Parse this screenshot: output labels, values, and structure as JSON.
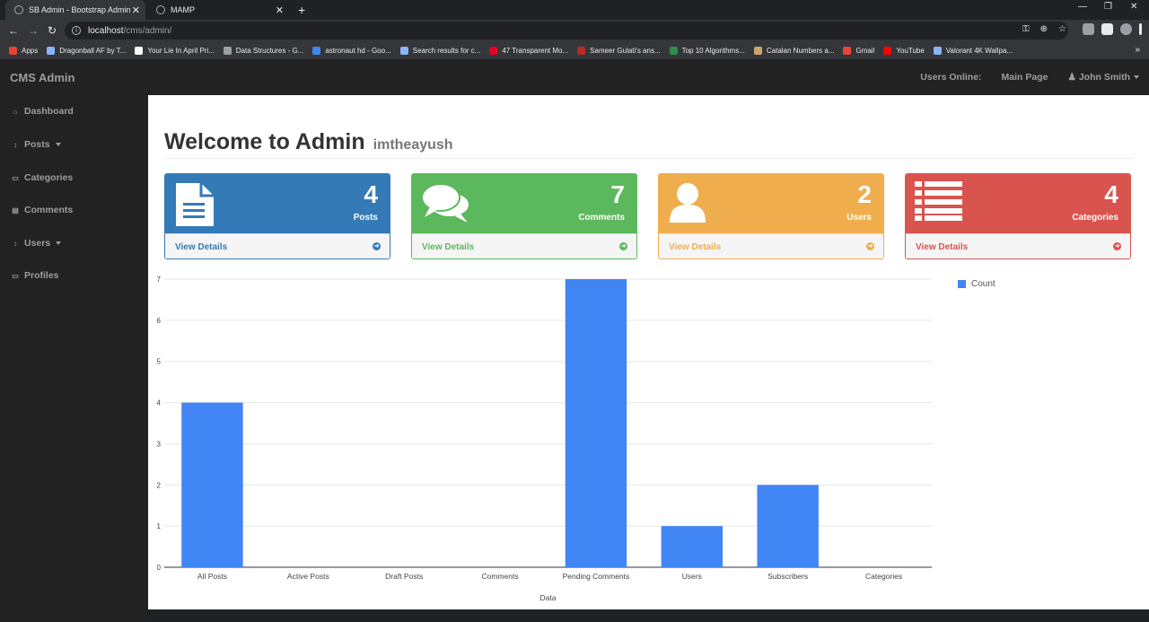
{
  "browser": {
    "tabs": [
      {
        "title": "SB Admin - Bootstrap Admin Ten",
        "close": "✕"
      },
      {
        "title": "MAMP",
        "close": "✕"
      }
    ],
    "new_tab": "+",
    "url_host": "localhost",
    "url_path": "/cms/admin/",
    "bookmarks": [
      {
        "label": "Apps",
        "color": "#e94235"
      },
      {
        "label": "Dragonball AF by T...",
        "color": "#8ab4f8"
      },
      {
        "label": "Your Lie In April Pri...",
        "color": "#ffffff"
      },
      {
        "label": "Data Structures - G...",
        "color": "#9aa0a6"
      },
      {
        "label": "astronaut hd - Goo...",
        "color": "#4285f4"
      },
      {
        "label": "Search results for c...",
        "color": "#8ab4f8"
      },
      {
        "label": "47 Transparent Mo...",
        "color": "#e60023"
      },
      {
        "label": "Sameer Gulati's ans...",
        "color": "#b92b27"
      },
      {
        "label": "Top 10 Algorithms...",
        "color": "#2f8d46"
      },
      {
        "label": "Catalan Numbers a...",
        "color": "#c9a66b"
      },
      {
        "label": "Gmail",
        "color": "#ea4335"
      },
      {
        "label": "YouTube",
        "color": "#ff0000"
      },
      {
        "label": "Valorant 4K Wallpa...",
        "color": "#8ab4f8"
      }
    ],
    "more_bookmarks": "»"
  },
  "navbar": {
    "brand": "CMS Admin",
    "users_online": "Users Online:",
    "main_page": "Main Page",
    "user": "John Smith"
  },
  "sidebar": {
    "items": [
      {
        "label": "Dashboard",
        "icon": "dashboard-icon",
        "glyph": "⌂"
      },
      {
        "label": "Posts",
        "icon": "arrows-icon",
        "glyph": "↕",
        "dropdown": true
      },
      {
        "label": "Categories",
        "icon": "desktop-icon",
        "glyph": "▭"
      },
      {
        "label": "Comments",
        "icon": "file-icon",
        "glyph": "▤"
      },
      {
        "label": "Users",
        "icon": "arrows-icon",
        "glyph": "↕",
        "dropdown": true
      },
      {
        "label": "Profiles",
        "icon": "desktop-icon",
        "glyph": "▭"
      }
    ]
  },
  "header": {
    "title": "Welcome to Admin",
    "subtitle": "imtheayush"
  },
  "panels": [
    {
      "count": "4",
      "label": "Posts",
      "link": "View Details",
      "color": "#337ab7",
      "icon": "file-text-icon"
    },
    {
      "count": "7",
      "label": "Comments",
      "link": "View Details",
      "color": "#5cb85c",
      "icon": "comments-icon"
    },
    {
      "count": "2",
      "label": "Users",
      "link": "View Details",
      "color": "#f0ad4e",
      "icon": "user-icon"
    },
    {
      "count": "4",
      "label": "Categories",
      "link": "View Details",
      "color": "#d9534f",
      "icon": "list-icon"
    }
  ],
  "chart_data": {
    "type": "bar",
    "categories": [
      "All Posts",
      "Active Posts",
      "Draft Posts",
      "Comments",
      "Pending Comments",
      "Users",
      "Subscribers",
      "Categories"
    ],
    "series": [
      {
        "name": "Count",
        "values": [
          4,
          0,
          0,
          0,
          7,
          1,
          2,
          0
        ]
      }
    ],
    "xlabel": "Data",
    "ylabel": "",
    "ylim": [
      0,
      7
    ],
    "yticks": [
      "0",
      "1",
      "2",
      "3",
      "4",
      "5",
      "6",
      "7"
    ],
    "grid": true,
    "legend": "right",
    "color": "#4285f4"
  }
}
